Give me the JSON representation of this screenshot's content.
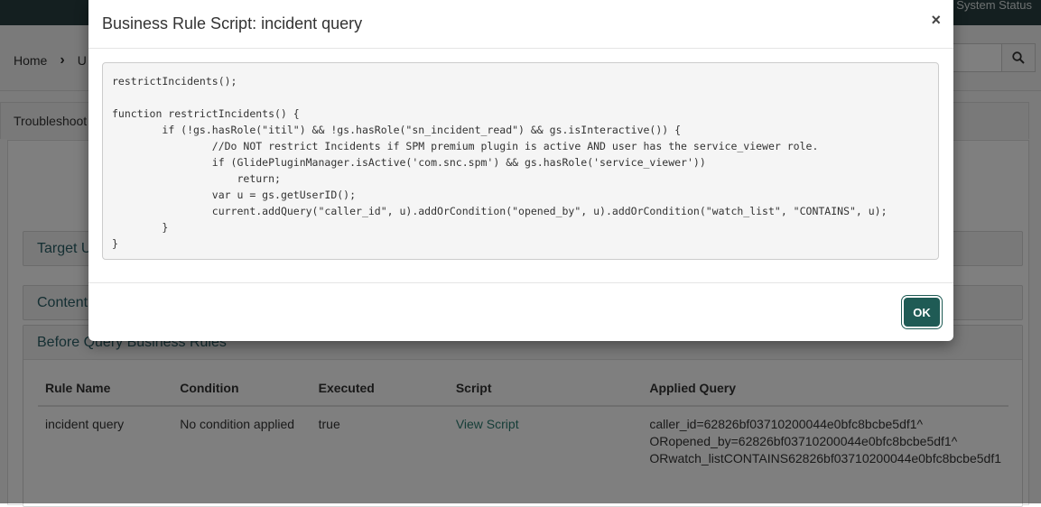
{
  "topbar": {
    "right_text": "System Status"
  },
  "breadcrumb": {
    "home": "Home",
    "next": "U"
  },
  "tab": {
    "label": "Troubleshoot"
  },
  "sections": {
    "target_users": "Target Use",
    "content_rules": "Content R",
    "before_query": "Before Query Business Rules"
  },
  "table": {
    "headers": [
      "Rule Name",
      "Condition",
      "Executed",
      "Script",
      "Applied Query"
    ],
    "rows": [
      {
        "rule_name": "incident query",
        "condition": "No condition applied",
        "executed": "true",
        "script_link": "View Script",
        "applied_query": [
          "caller_id=62826bf03710200044e0bfc8bcbe5df1^",
          "ORopened_by=62826bf03710200044e0bfc8bcbe5df1^",
          "ORwatch_listCONTAINS62826bf03710200044e0bfc8bcbe5df1"
        ]
      }
    ]
  },
  "modal": {
    "title": "Business Rule Script: incident query",
    "close_glyph": "×",
    "code": "restrictIncidents();\n\nfunction restrictIncidents() {\n\tif (!gs.hasRole(\"itil\") && !gs.hasRole(\"sn_incident_read\") && gs.isInteractive()) {\n\t\t//Do NOT restrict Incidents if SPM premium plugin is active AND user has the service_viewer role.\n\t\tif (GlidePluginManager.isActive('com.snc.spm') && gs.hasRole('service_viewer'))\n\t\t    return;\n\t\tvar u = gs.getUserID();\n\t\tcurrent.addQuery(\"caller_id\", u).addOrCondition(\"opened_by\", u).addOrCondition(\"watch_list\", \"CONTAINS\", u);\n\t}\n}",
    "ok_label": "OK"
  },
  "icons": {
    "search": "search-icon",
    "breadcrumb_sep": "chevron-right-icon"
  },
  "colors": {
    "brand_dark": "#293e40",
    "button": "#1f5b55",
    "link": "#2a7a6f"
  }
}
